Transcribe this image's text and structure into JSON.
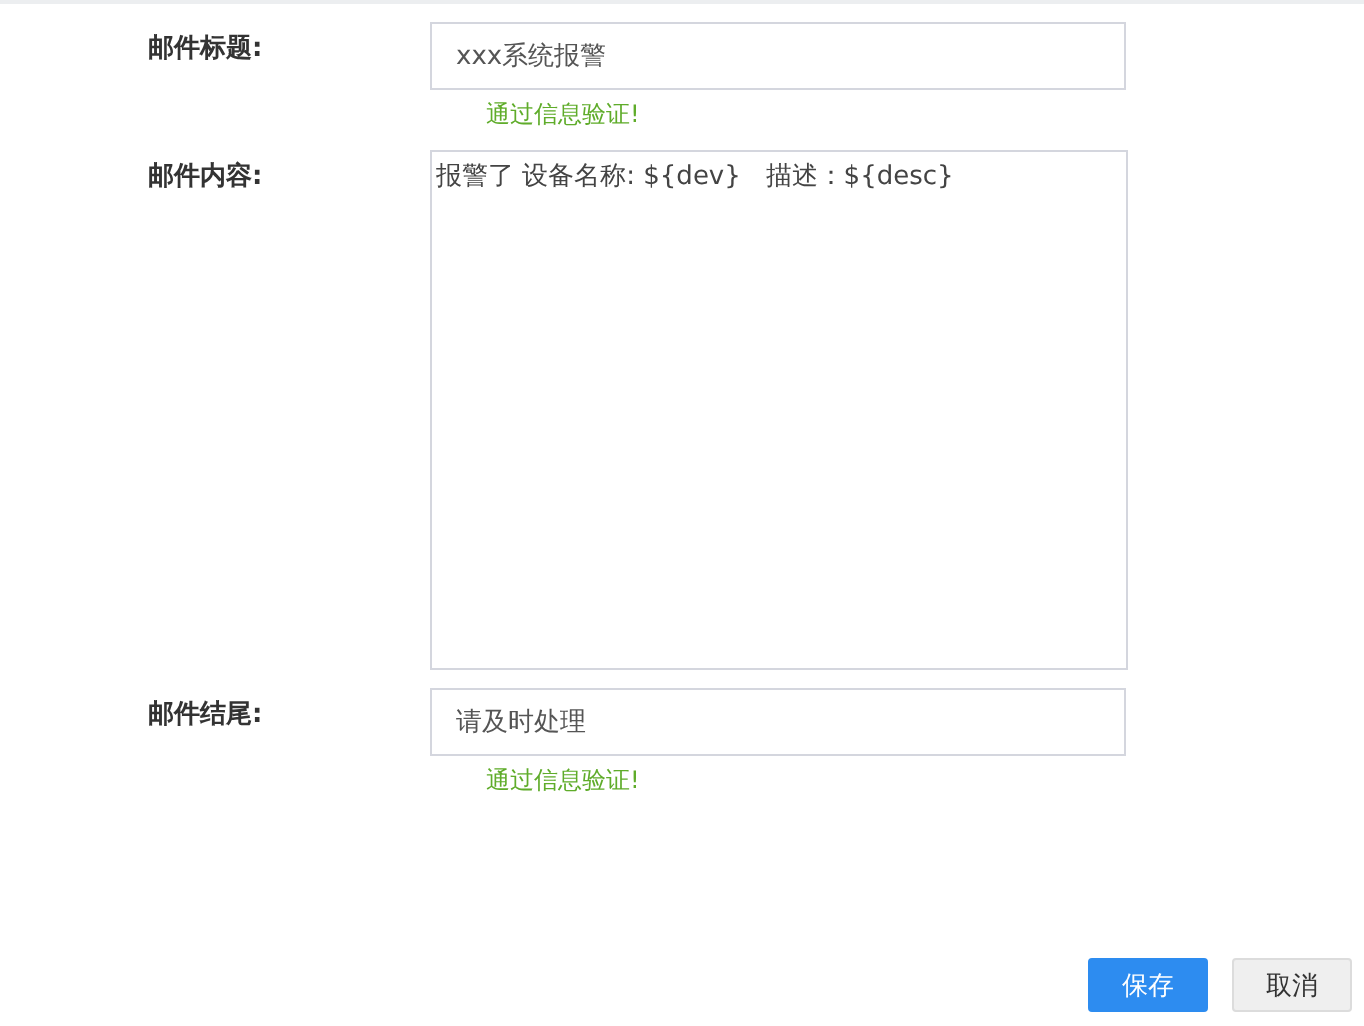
{
  "fields": [
    {
      "label": "邮件标题:",
      "kind": "input",
      "value": "xxx系统报警",
      "hint": "通过信息验证!"
    },
    {
      "label": "邮件内容:",
      "kind": "textarea",
      "value": "报警了 设备名称: ${dev}   描述：${desc}"
    },
    {
      "label": "邮件结尾:",
      "kind": "input",
      "value": "请及时处理",
      "hint": "通过信息验证!"
    }
  ],
  "buttons": [
    {
      "label": "保存",
      "kind": "primary"
    },
    {
      "label": "取消",
      "kind": "default"
    }
  ]
}
